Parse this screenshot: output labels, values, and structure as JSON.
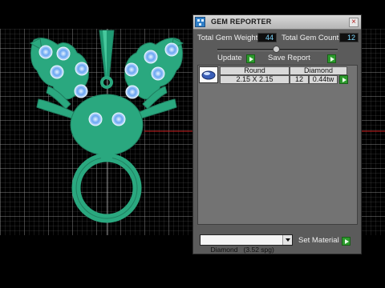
{
  "panel": {
    "title": "GEM REPORTER",
    "close_symbol": "×",
    "total_gem_weight_label": "Total Gem Weight",
    "total_gem_weight_value": "44",
    "total_gem_count_label": "Total Gem Count",
    "total_gem_count_value": "12",
    "update_label": "Update",
    "save_report_label": "Save Report",
    "gem_table": {
      "headers": [
        "Round",
        "Diamond"
      ],
      "rows": [
        {
          "size": "2.15 X 2.15",
          "count": "12",
          "weight": "0.44tw"
        }
      ]
    },
    "material_dropdown": "Diamond   (3.52 spg)",
    "set_material_label": "Set Material"
  },
  "colors": {
    "model_green": "#2aa87f",
    "gem_blue": "#9ec8ff",
    "grid": "#8a8a8a",
    "axis_red": "#d02020",
    "panel_bg": "#5b5b5b"
  }
}
